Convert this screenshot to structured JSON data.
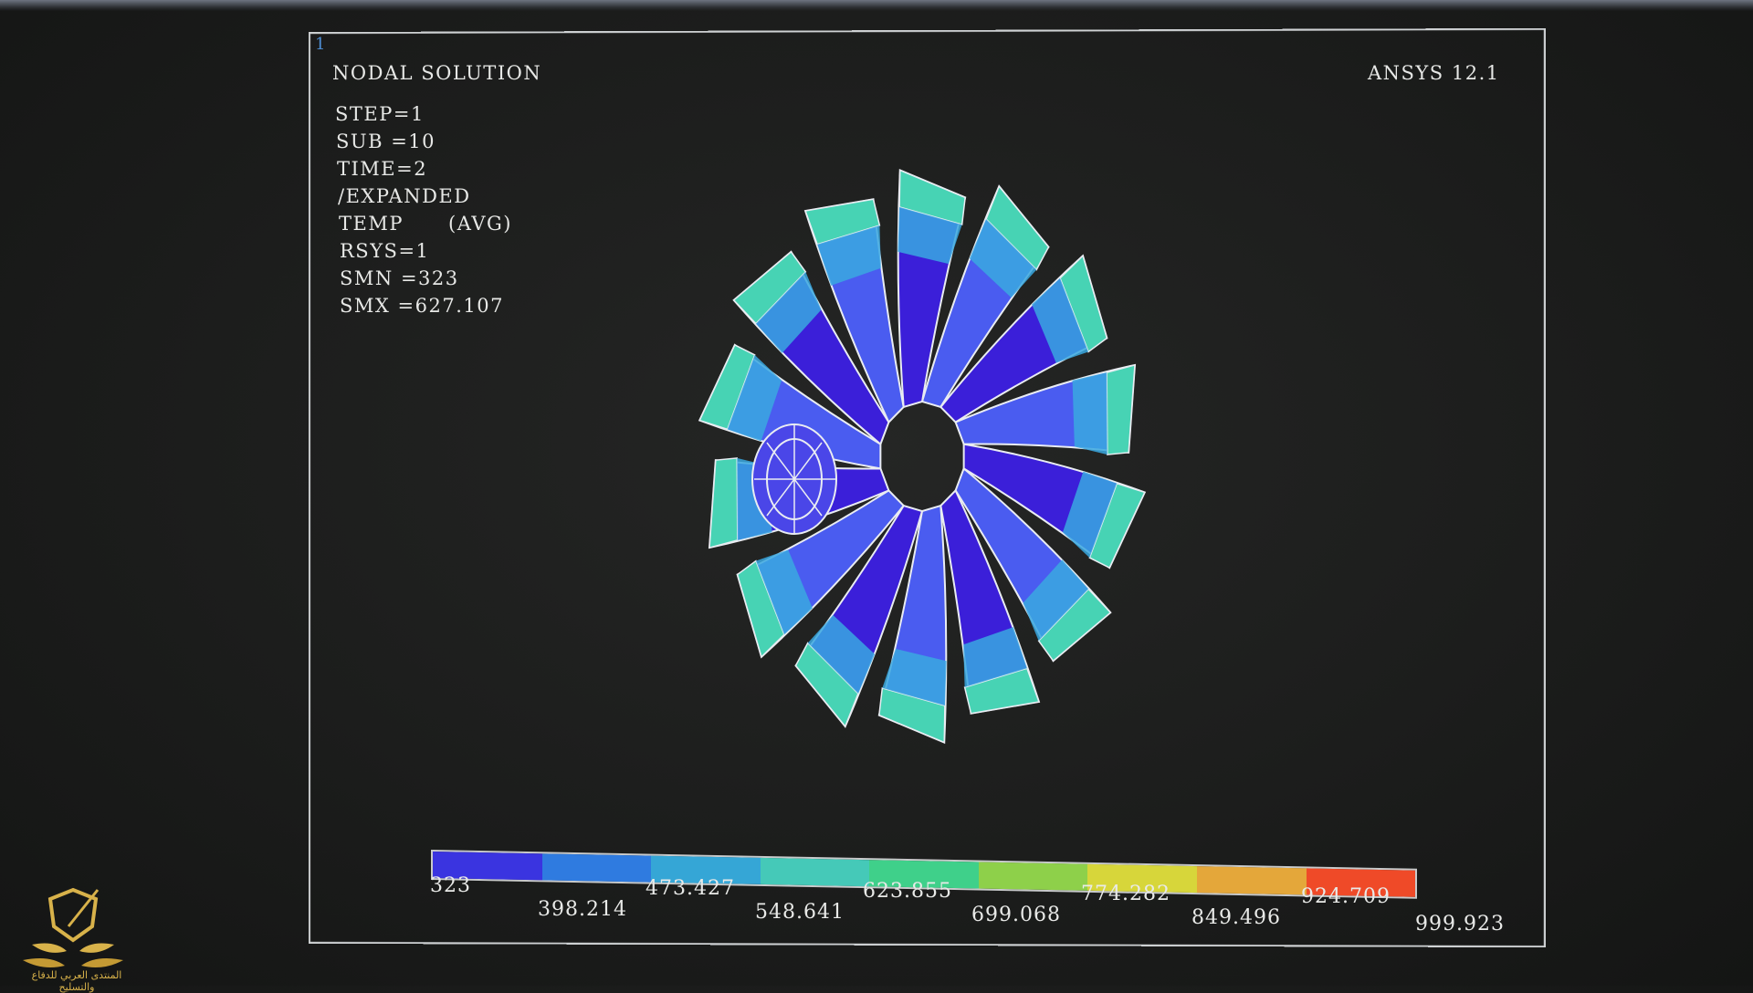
{
  "frame_number": "1",
  "header": {
    "title": "NODAL SOLUTION",
    "version": "ANSYS 12.1"
  },
  "info": {
    "step": "STEP=1",
    "sub": "SUB =10",
    "time": "TIME=2",
    "expanded": "/EXPANDED",
    "temp": "TEMP      (AVG)",
    "rsys": "RSYS=1",
    "smn": "SMN =323",
    "smx": "SMX =627.107"
  },
  "legend": {
    "colors": [
      "#3a34e0",
      "#2f7be0",
      "#35a6d6",
      "#45c9b8",
      "#3fd08a",
      "#8ed04a",
      "#d7d63a",
      "#e4a73a",
      "#ef4a28"
    ],
    "ticks": [
      "323",
      "398.214",
      "473.427",
      "548.641",
      "623.855",
      "699.068",
      "774.282",
      "849.496",
      "924.709",
      "999.923"
    ]
  },
  "watermark": {
    "text": "المنتدى العربي للدفاع والتسليح",
    "accent": "#d8b24a"
  },
  "model_colors": {
    "blade_deep": "#3b1fd9",
    "blade_mid": "#4a5cf0",
    "blade_light": "#3aa8e0",
    "blade_tip": "#47d3b4",
    "outline": "#e9ecf2"
  }
}
